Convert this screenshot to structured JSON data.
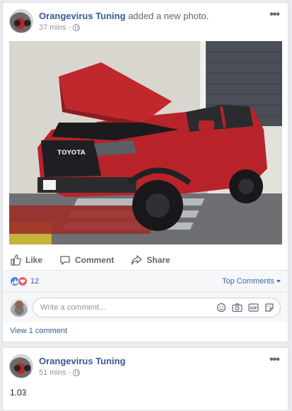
{
  "post1": {
    "author": "Orangevirus Tuning",
    "action": "added a new photo.",
    "time": "37 mins",
    "separator": "·",
    "more_icon": "ellipsis-icon",
    "photo_alt": "",
    "actions": {
      "like": "Like",
      "comment": "Comment",
      "share": "Share"
    },
    "reactions": {
      "count": "12",
      "sort_label": "Top Comments"
    },
    "composer": {
      "placeholder": "Write a comment..."
    },
    "view_comments": "View 1 comment"
  },
  "post2": {
    "author": "Orangevirus Tuning",
    "time": "51 mins",
    "separator": "·",
    "text": "1.03"
  },
  "colors": {
    "link": "#365899",
    "accent": "#4267b2",
    "muted": "#90949c",
    "like_blue": "#4080ff",
    "love_red": "#f25268",
    "truck_red": "#c0282d"
  }
}
